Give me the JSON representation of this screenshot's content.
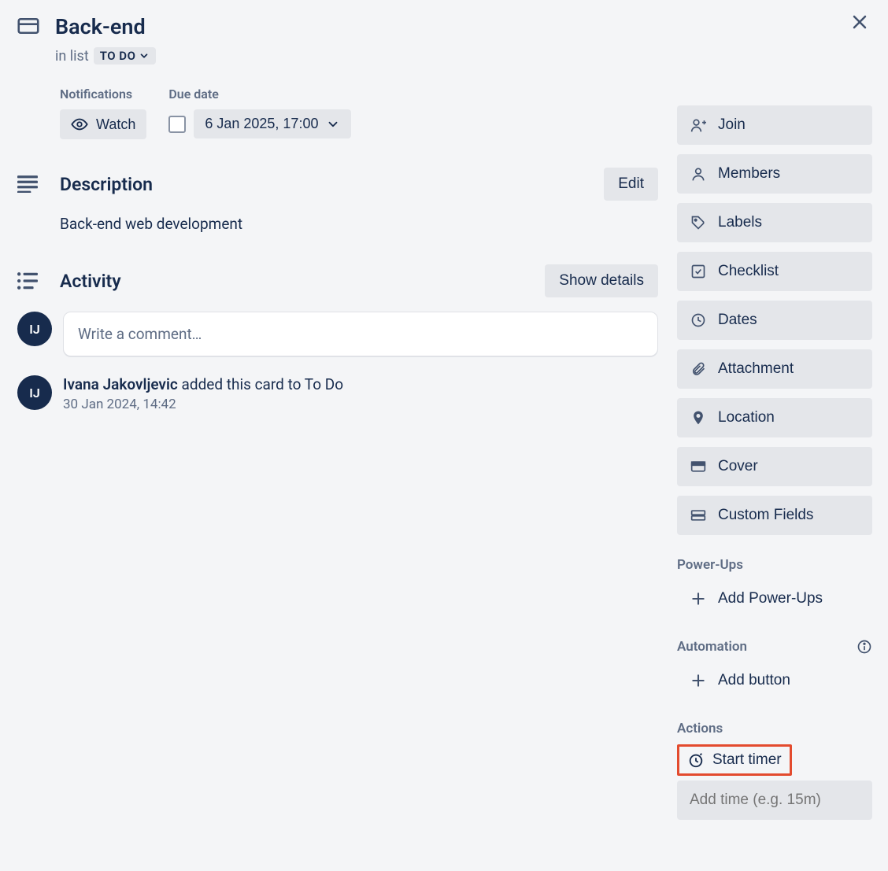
{
  "card": {
    "title": "Back-end",
    "in_list_prefix": "in list",
    "list_name": "TO DO"
  },
  "details": {
    "notifications_label": "Notifications",
    "watch_label": "Watch",
    "due_label": "Due date",
    "due_value": "6 Jan 2025, 17:00"
  },
  "description": {
    "heading": "Description",
    "edit_label": "Edit",
    "text": "Back-end web development"
  },
  "activity": {
    "heading": "Activity",
    "show_details_label": "Show details",
    "avatar_initials": "IJ",
    "comment_placeholder": "Write a comment…",
    "item_author": "Ivana Jakovljevic",
    "item_action": "added this card to To Do",
    "item_date": "30 Jan 2024, 14:42"
  },
  "sidebar": {
    "join": "Join",
    "members": "Members",
    "labels": "Labels",
    "checklist": "Checklist",
    "dates": "Dates",
    "attachment": "Attachment",
    "location": "Location",
    "cover": "Cover",
    "custom_fields": "Custom Fields",
    "powerups_heading": "Power-Ups",
    "add_powerups": "Add Power-Ups",
    "automation_heading": "Automation",
    "add_button": "Add button",
    "actions_heading": "Actions",
    "start_timer": "Start timer",
    "add_time_placeholder": "Add time (e.g. 15m)"
  }
}
